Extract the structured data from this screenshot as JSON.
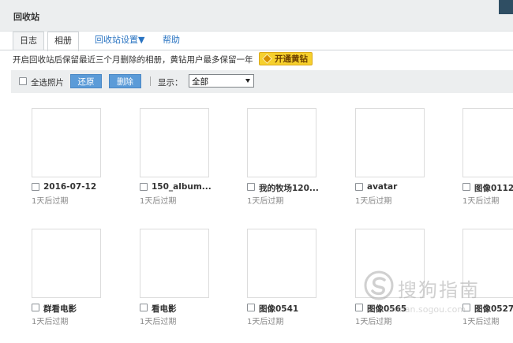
{
  "window": {
    "title": "回收站"
  },
  "tabs": [
    {
      "label": "日志"
    },
    {
      "label": "相册"
    },
    {
      "label": "回收站设置▼"
    },
    {
      "label": "帮助"
    }
  ],
  "notice": {
    "text": "开启回收站后保留最近三个月删除的相册，黄钻用户最多保留一年",
    "vip_button": "开通黄钻"
  },
  "toolbar": {
    "select_all": "全选照片",
    "restore": "还原",
    "delete": "删除",
    "display_label": "显示：",
    "display_value": "全部"
  },
  "photos": [
    {
      "name": "2016-07-12",
      "expiry": "1天后过期"
    },
    {
      "name": "150_album...",
      "expiry": "1天后过期"
    },
    {
      "name": "我的牧场120...",
      "expiry": "1天后过期"
    },
    {
      "name": "avatar",
      "expiry": "1天后过期"
    },
    {
      "name": "图像0112",
      "expiry": "1天后过期"
    },
    {
      "name": "群看电影",
      "expiry": "1天后过期"
    },
    {
      "name": "看电影",
      "expiry": "1天后过期"
    },
    {
      "name": "图像0541",
      "expiry": "1天后过期"
    },
    {
      "name": "图像0565",
      "expiry": "1天后过期"
    },
    {
      "name": "图像0527",
      "expiry": "1天后过期"
    }
  ],
  "watermark": {
    "text": "搜狗指南",
    "url": "zhinan.sogou.com"
  },
  "colors": {
    "button_blue": "#5b9bd8",
    "vip_yellow": "#f6d02d",
    "link_blue": "#2a74c2"
  }
}
